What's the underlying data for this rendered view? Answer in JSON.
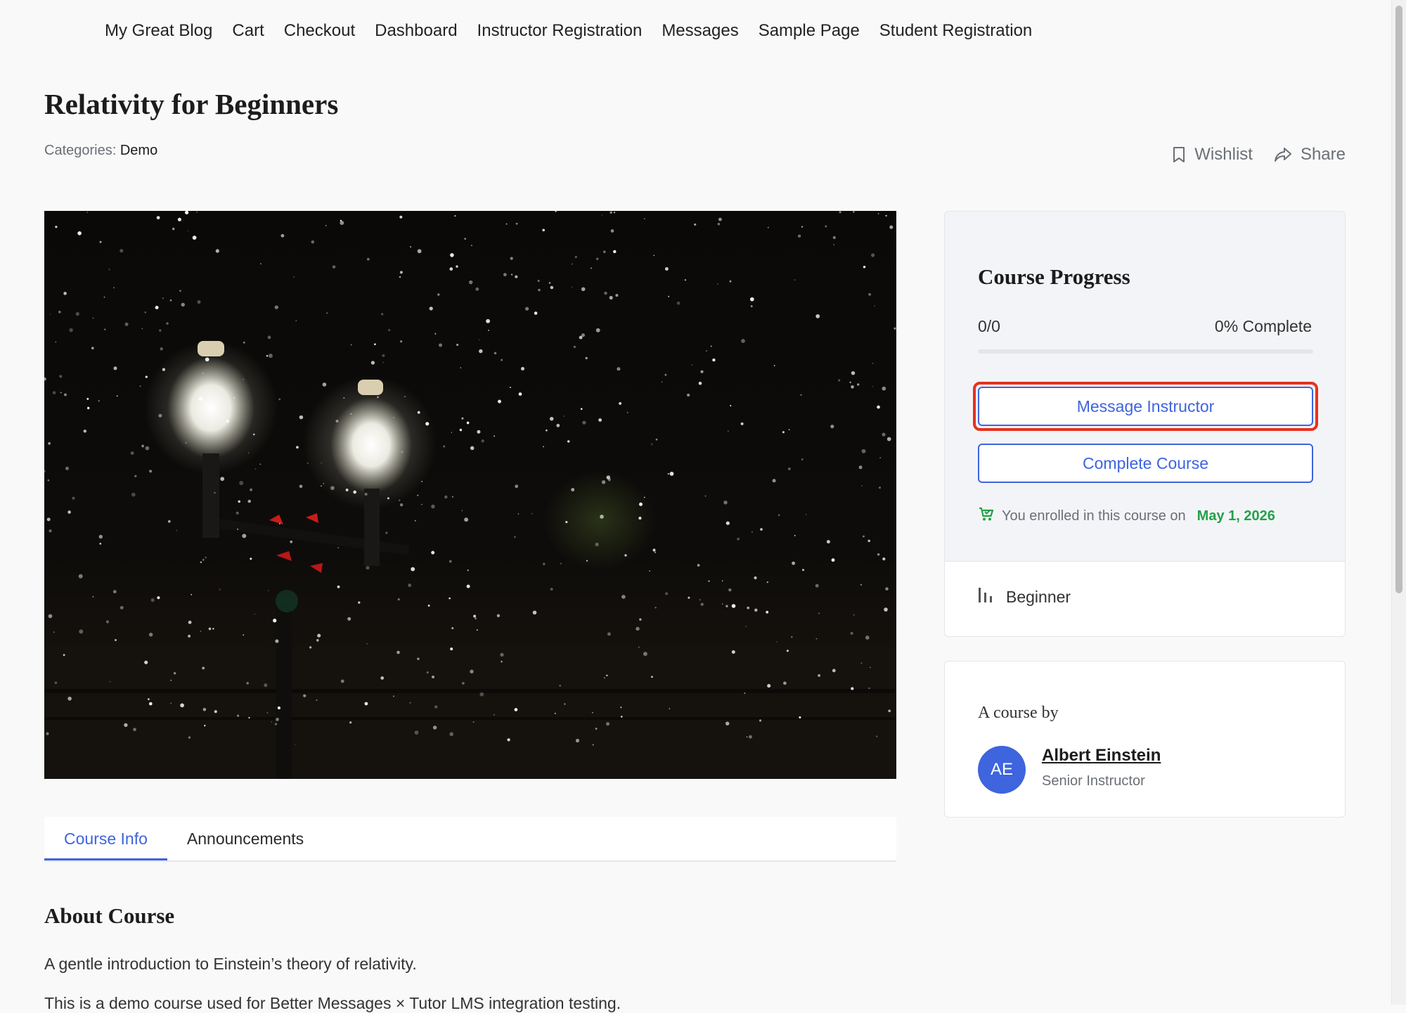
{
  "nav": {
    "items": [
      {
        "label": "My Great Blog"
      },
      {
        "label": "Cart"
      },
      {
        "label": "Checkout"
      },
      {
        "label": "Dashboard"
      },
      {
        "label": "Instructor Registration"
      },
      {
        "label": "Messages"
      },
      {
        "label": "Sample Page"
      },
      {
        "label": "Student Registration"
      }
    ]
  },
  "course": {
    "title": "Relativity for Beginners",
    "categories_label": "Categories:",
    "category": "Demo"
  },
  "actions": {
    "wishlist": "Wishlist",
    "wishlist_icon": "bookmark-icon",
    "share": "Share",
    "share_icon": "share-icon"
  },
  "tabs": [
    {
      "label": "Course Info",
      "active": true
    },
    {
      "label": "Announcements",
      "active": false
    }
  ],
  "about": {
    "heading": "About Course",
    "p1": "A gentle introduction to Einstein’s theory of relativity.",
    "p2": "This is a demo course used for Better Messages × Tutor LMS integration testing."
  },
  "progress": {
    "title": "Course Progress",
    "count": "0/0",
    "percent_label": "0% Complete",
    "percent": 0,
    "message_button": "Message Instructor",
    "complete_button": "Complete Course",
    "enrolled_text": "You enrolled in this course on",
    "enrolled_date": "May 1, 2026",
    "enrolled_icon": "cart-icon",
    "level": "Beginner",
    "level_icon": "level-bars-icon"
  },
  "instructor": {
    "by_label": "A course by",
    "initials": "AE",
    "name": "Albert Einstein",
    "role": "Senior Instructor"
  },
  "colors": {
    "accent": "#3e64de",
    "success": "#24a148",
    "highlight": "#e8311e"
  }
}
